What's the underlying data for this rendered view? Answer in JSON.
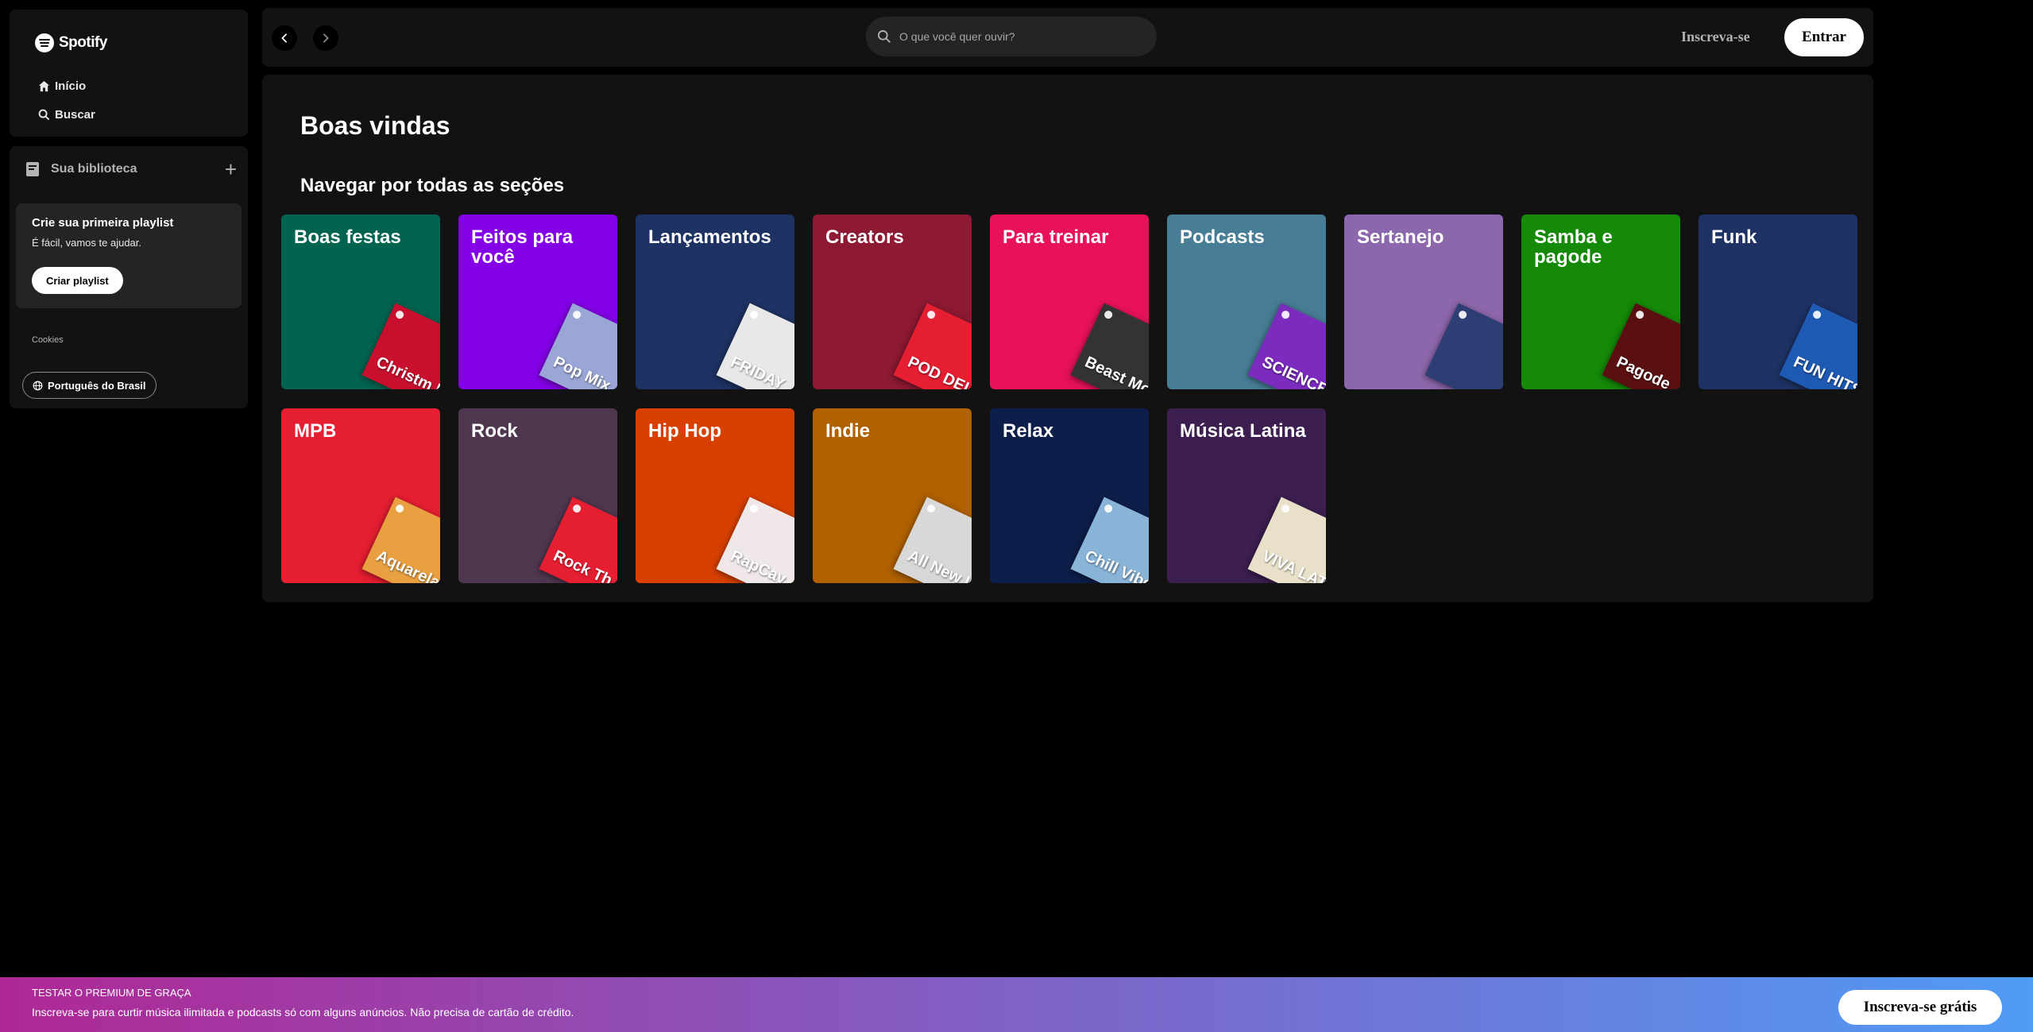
{
  "sidebar": {
    "logo_text": "Spotify",
    "nav": [
      {
        "label": "Início",
        "icon": "home-icon"
      },
      {
        "label": "Buscar",
        "icon": "search-icon"
      }
    ],
    "library": {
      "title": "Sua biblioteca",
      "create_card": {
        "title": "Crie sua primeira playlist",
        "subtitle": "É fácil, vamos te ajudar.",
        "button": "Criar playlist"
      },
      "cookies": "Cookies",
      "language_button": "Português do Brasil"
    }
  },
  "topbar": {
    "search_placeholder": "O que você quer ouvir?",
    "signup": "Inscreva-se",
    "login": "Entrar"
  },
  "main": {
    "title": "Boas vindas",
    "section_title": "Navegar por todas as seções",
    "categories": [
      {
        "label": "Boas festas",
        "color": "#006450",
        "art_color": "#c8102e",
        "art_text": "Christm Hit"
      },
      {
        "label": "Feitos para você",
        "color": "#8400e7",
        "art_color": "#9aa7d6",
        "art_text": "Pop Mix"
      },
      {
        "label": "Lançamentos",
        "color": "#1e3264",
        "art_color": "#e8e8e8",
        "art_text": "FRIDAY"
      },
      {
        "label": "Creators",
        "color": "#8d1932",
        "art_color": "#e61e32",
        "art_text": "POD DELAS"
      },
      {
        "label": "Para treinar",
        "color": "#e8115b",
        "art_color": "#333333",
        "art_text": "Beast Mode"
      },
      {
        "label": "Podcasts",
        "color": "#477d95",
        "art_color": "#7b2cbf",
        "art_text": "SCIENCE VS"
      },
      {
        "label": "Sertanejo",
        "color": "#8d67ab",
        "art_color": "#2d3e74",
        "art_text": ""
      },
      {
        "label": "Samba e pagode",
        "color": "#148a08",
        "art_color": "#5a1010",
        "art_text": "Pagode"
      },
      {
        "label": "Funk",
        "color": "#1e3264",
        "art_color": "#1e5ab4",
        "art_text": "FUN HITS"
      },
      {
        "label": "MPB",
        "color": "#e61e32",
        "art_color": "#e8a040",
        "art_text": "Aquarela Brasileira"
      },
      {
        "label": "Rock",
        "color": "#503750",
        "art_color": "#e61e32",
        "art_text": "Rock Th"
      },
      {
        "label": "Hip Hop",
        "color": "#d84000",
        "art_color": "#f0e8e8",
        "art_text": "RapCav"
      },
      {
        "label": "Indie",
        "color": "#b06100",
        "art_color": "#d8d8d8",
        "art_text": "All New Indi"
      },
      {
        "label": "Relax",
        "color": "#0d1e4a",
        "art_color": "#89b4d8",
        "art_text": "Chill Vibes"
      },
      {
        "label": "Música Latina",
        "color": "#3c1e50",
        "art_color": "#e8e0c8",
        "art_text": "VIVA LATINO"
      }
    ]
  },
  "banner": {
    "title": "TESTAR O PREMIUM DE GRAÇA",
    "subtitle": "Inscreva-se para curtir música ilimitada e podcasts só com alguns anúncios. Não precisa de cartão de crédito.",
    "button": "Inscreva-se grátis"
  }
}
